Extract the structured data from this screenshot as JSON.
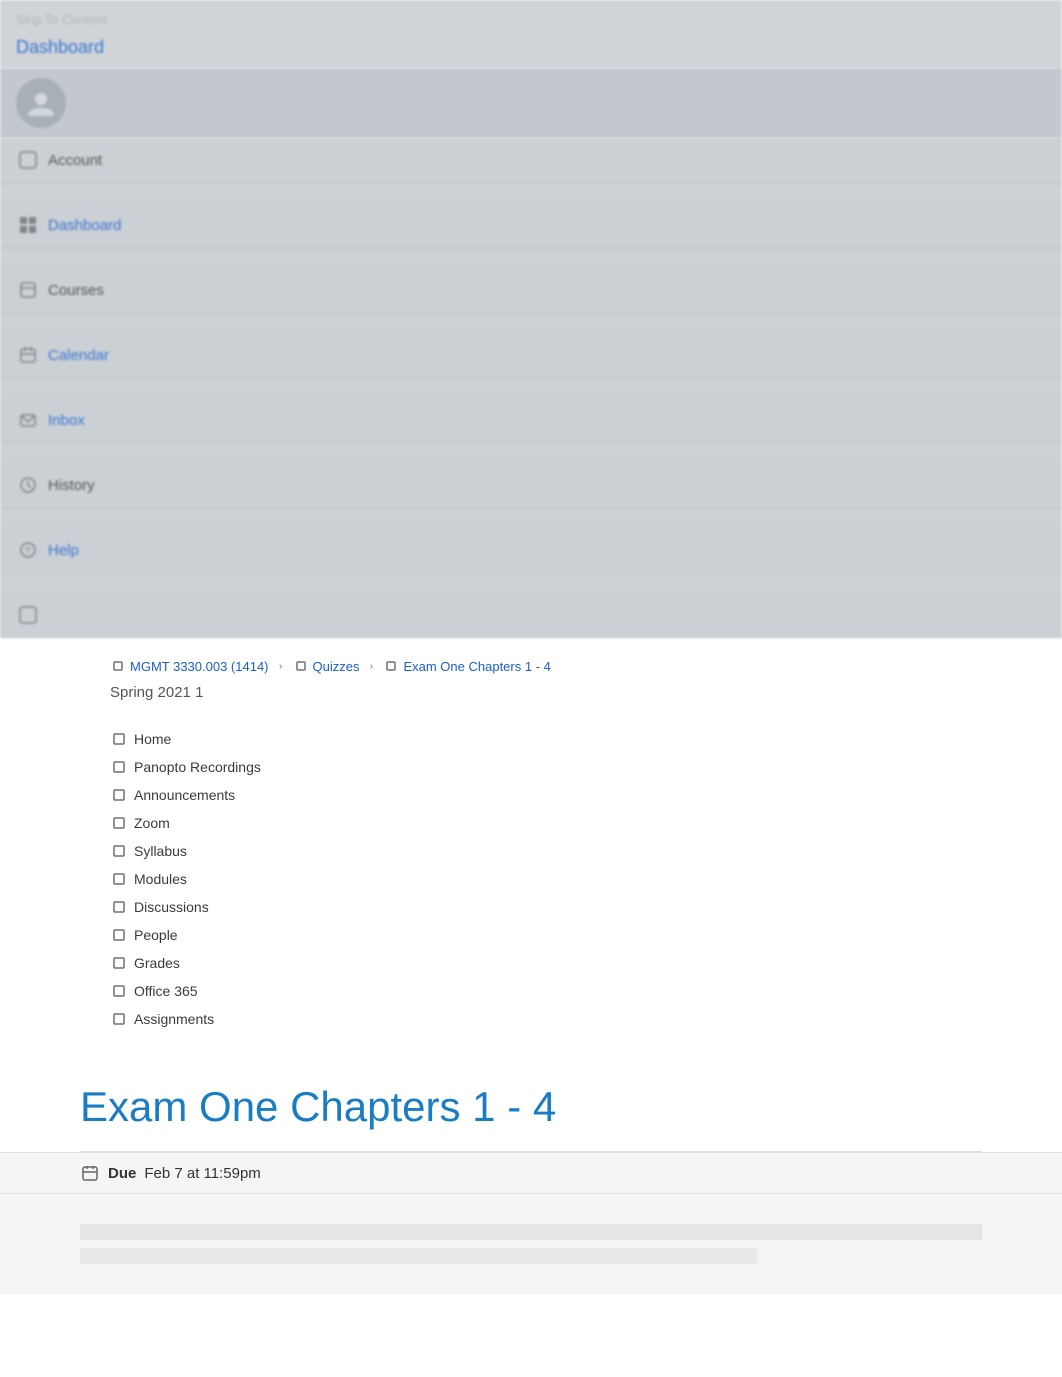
{
  "skipLink": "Skip To Content",
  "topNav": {
    "dashboardLink": "Dashboard",
    "navItems": [
      {
        "id": "account",
        "label": "Account",
        "icon": "👤",
        "isBlue": false
      },
      {
        "id": "dashboard",
        "label": "Dashboard",
        "icon": "",
        "isBlue": true
      },
      {
        "id": "courses",
        "label": "Courses",
        "icon": "📚",
        "isBlue": false
      },
      {
        "id": "calendar",
        "label": "Calendar",
        "icon": "",
        "isBlue": true
      },
      {
        "id": "inbox",
        "label": "Inbox",
        "icon": "",
        "isBlue": true
      },
      {
        "id": "history",
        "label": "History",
        "icon": "🕐",
        "isBlue": false
      },
      {
        "id": "help",
        "label": "Help",
        "icon": "",
        "isBlue": true
      }
    ]
  },
  "breadcrumb": {
    "course": "MGMT 3330.003 (1414)",
    "section": "Quizzes",
    "current": "Exam One Chapters 1 - 4"
  },
  "courseSubtitle": "Spring 2021 1",
  "courseNav": {
    "items": [
      {
        "label": "Home"
      },
      {
        "label": "Panopto Recordings"
      },
      {
        "label": "Announcements"
      },
      {
        "label": "Zoom"
      },
      {
        "label": "Syllabus"
      },
      {
        "label": "Modules"
      },
      {
        "label": "Discussions"
      },
      {
        "label": "People"
      },
      {
        "label": "Grades"
      },
      {
        "label": "Office 365"
      },
      {
        "label": "Assignments"
      }
    ]
  },
  "pageTitle": "Exam One Chapters 1 - 4",
  "dueSection": {
    "icon": "📅",
    "dueLabel": "Due",
    "dueDate": "Feb 7 at 11:59pm"
  }
}
